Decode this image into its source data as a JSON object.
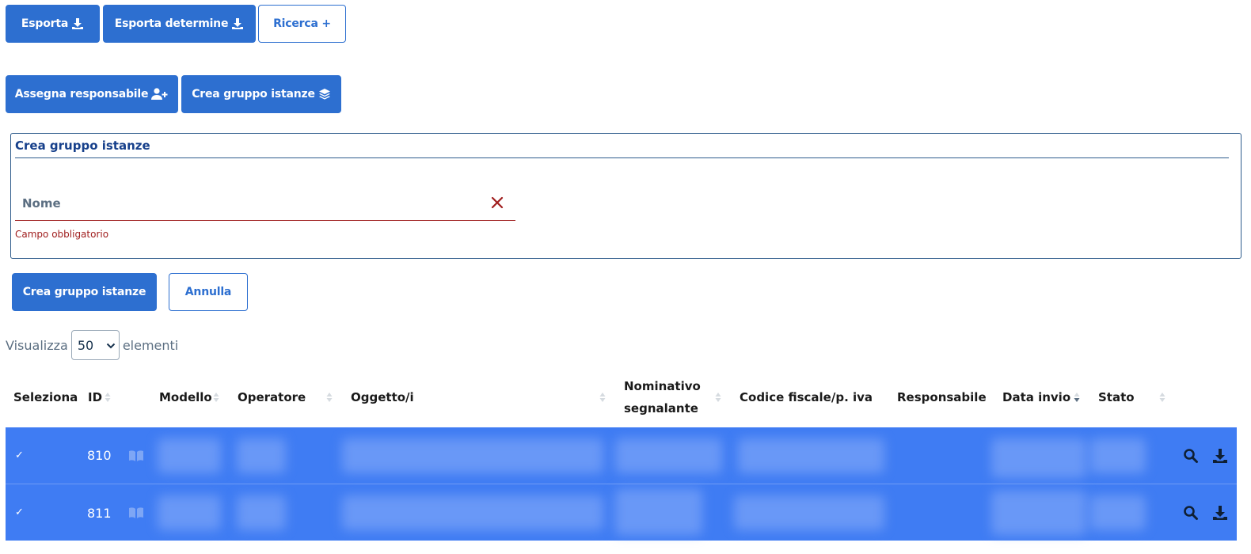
{
  "toolbar": {
    "export_label": "Esporta",
    "export_determine_label": "Esporta determine",
    "search_label": "Ricerca +",
    "assign_label": "Assegna responsabile",
    "create_group_label": "Crea gruppo istanze"
  },
  "panel": {
    "title": "Crea gruppo istanze",
    "name_label": "Nome",
    "name_value": "",
    "error_text": "Campo obbligatorio",
    "submit_label": "Crea gruppo istanze",
    "cancel_label": "Annulla"
  },
  "page_length": {
    "prefix": "Visualizza",
    "selected": "50",
    "suffix": "elementi"
  },
  "table": {
    "columns": {
      "select": "Seleziona",
      "id": "ID",
      "model": "Modello",
      "operator": "Operatore",
      "objects": "Oggetto/i",
      "reporter_line1": "Nominativo",
      "reporter_line2": "segnalante",
      "tax_code": "Codice fiscale/p. iva",
      "manager": "Responsabile",
      "sent_date": "Data invio",
      "status": "Stato"
    },
    "rows": [
      {
        "check": "✓",
        "id": "810"
      },
      {
        "check": "✓",
        "id": "811"
      }
    ]
  },
  "colors": {
    "primary": "#2d6fd0",
    "selected_row": "#3f7cf3",
    "error": "#a01e1e"
  },
  "icons": [
    "download-icon",
    "user-plus-icon",
    "layers-icon",
    "close-icon",
    "chevron-down-icon",
    "sort-icon",
    "book-icon",
    "search-icon"
  ]
}
